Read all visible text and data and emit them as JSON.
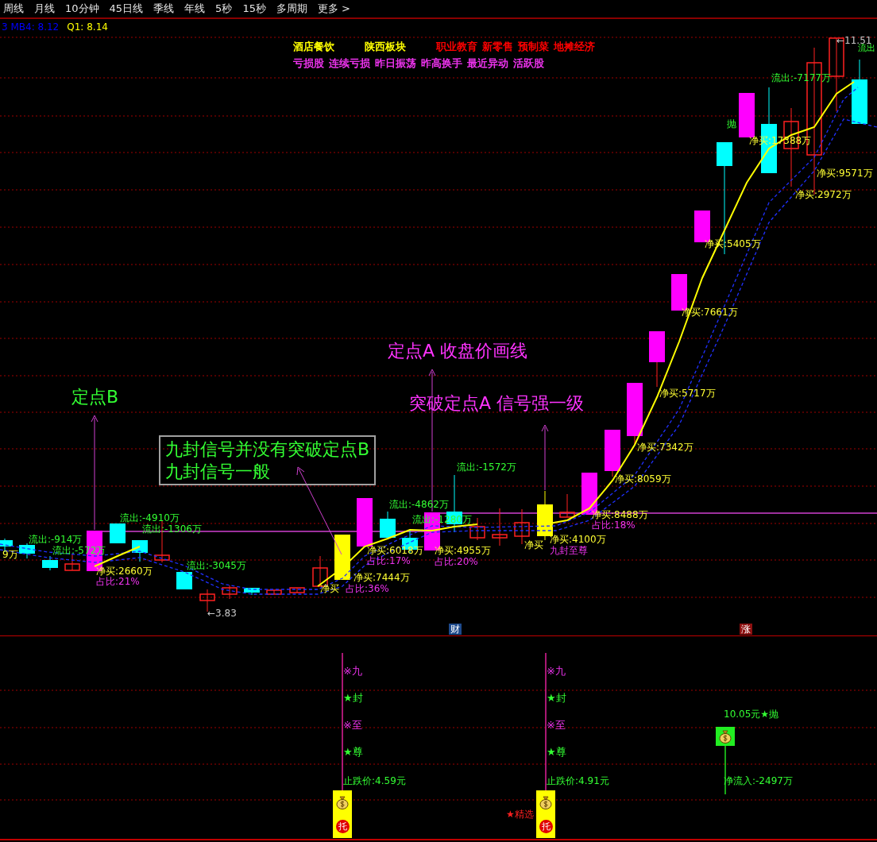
{
  "period_tabs": [
    {
      "label": "周线"
    },
    {
      "label": "月线"
    },
    {
      "label": "10分钟"
    },
    {
      "label": "45日线"
    },
    {
      "label": "季线"
    },
    {
      "label": "年线"
    },
    {
      "label": "5秒"
    },
    {
      "label": "15秒"
    },
    {
      "label": "多周期"
    },
    {
      "label": "更多 >"
    }
  ],
  "indicator_readout": [
    {
      "text": "3 MB4: 8.12",
      "color": "#0000ff"
    },
    {
      "text": "Q1: 8.14",
      "color": "#ffff00"
    }
  ],
  "concept_tags": [
    {
      "label": "酒店餐饮",
      "color": "#ffff00"
    },
    {
      "label": "陕西板块",
      "color": "#ffff00"
    },
    {
      "label": "职业教育",
      "color": "#ff0000"
    },
    {
      "label": "新零售",
      "color": "#ff0000"
    },
    {
      "label": "预制菜",
      "color": "#ff0000"
    },
    {
      "label": "地摊经济",
      "color": "#ff0000"
    }
  ],
  "status_tags": [
    "亏损股",
    "连续亏损",
    "昨日振荡",
    "昨高换手",
    "最近异动",
    "活跃股"
  ],
  "main_chart": {
    "labels": [
      {
        "kind": "price",
        "text": "←11.51"
      },
      {
        "kind": "outflow",
        "text": "流出"
      },
      {
        "kind": "outflow",
        "text": "流出:-7177万"
      },
      {
        "kind": "sell",
        "text": "抛"
      },
      {
        "kind": "net_buy",
        "text": "净买:17388万"
      },
      {
        "kind": "net_buy",
        "text": "净买:9571万"
      },
      {
        "kind": "net_buy",
        "text": "净买:2972万"
      },
      {
        "kind": "net_buy",
        "text": "净买:5405万"
      },
      {
        "kind": "net_buy",
        "text": "净买:7661万"
      },
      {
        "kind": "net_buy",
        "text": "净买:5717万"
      },
      {
        "kind": "net_buy",
        "text": "净买:7342万"
      },
      {
        "kind": "outflow",
        "text": "流出:-1572万"
      },
      {
        "kind": "net_buy",
        "text": "净买:8059万"
      },
      {
        "kind": "outflow",
        "text": "流出:-4862万"
      },
      {
        "kind": "net_buy",
        "text": "净买:8488万"
      },
      {
        "kind": "outflow",
        "text": "流出:-4910万"
      },
      {
        "kind": "outflow",
        "text": "流出:-1280万"
      },
      {
        "kind": "ratio",
        "text": "占比:18%"
      },
      {
        "kind": "outflow",
        "text": "流出:-1306万"
      },
      {
        "kind": "outflow",
        "text": "流出:-914万"
      },
      {
        "kind": "net_buy",
        "text": "净买:4100万"
      },
      {
        "kind": "net_buy",
        "text": "净买"
      },
      {
        "kind": "outflow",
        "text": "流出:-572万"
      },
      {
        "kind": "net_buy",
        "text": "净买:6018万"
      },
      {
        "kind": "net_buy",
        "text": "净买:4955万"
      },
      {
        "kind": "signal",
        "text": "九封至尊"
      },
      {
        "kind": "net_buy",
        "text": "9万"
      },
      {
        "kind": "ratio",
        "text": "占比:17%"
      },
      {
        "kind": "ratio",
        "text": "占比:20%"
      },
      {
        "kind": "outflow",
        "text": "流出:-3045万"
      },
      {
        "kind": "net_buy",
        "text": "净买:2660万"
      },
      {
        "kind": "net_buy",
        "text": "净买:7444万"
      },
      {
        "kind": "ratio",
        "text": "占比:21%"
      },
      {
        "kind": "net_buy",
        "text": "净买"
      },
      {
        "kind": "ratio",
        "text": "占比:36%"
      },
      {
        "kind": "price",
        "text": "←3.83"
      }
    ],
    "annotations": [
      {
        "text": "定点B",
        "color": "#33ff33"
      },
      {
        "text": "定点A 收盘价画线",
        "color": "#ff33ff"
      },
      {
        "text": "突破定点A 信号强一级",
        "color": "#ff33ff"
      }
    ],
    "note_box": {
      "lines": [
        "九封信号并没有突破定点B",
        "九封信号一般"
      ]
    },
    "markers": [
      {
        "kind": "finance",
        "text": "财"
      },
      {
        "kind": "rise",
        "text": "涨"
      }
    ]
  },
  "signal_panel": {
    "signals": [
      {
        "marks": [
          {
            "kind": "note",
            "text": "※九"
          },
          {
            "kind": "star",
            "text": "★封"
          },
          {
            "kind": "note",
            "text": "※至"
          },
          {
            "kind": "star",
            "text": "★尊"
          }
        ],
        "stop_price": "止跌价:4.59元",
        "badge": "托"
      },
      {
        "marks": [
          {
            "kind": "note",
            "text": "※九"
          },
          {
            "kind": "star",
            "text": "★封"
          },
          {
            "kind": "note",
            "text": "※至"
          },
          {
            "kind": "star",
            "text": "★尊"
          }
        ],
        "stop_price": "止跌价:4.91元",
        "badge": "托",
        "pick": "★精选"
      }
    ],
    "sell_point": {
      "price": "10.05元★抛",
      "net_inflow": "净流入:-2497万"
    }
  }
}
